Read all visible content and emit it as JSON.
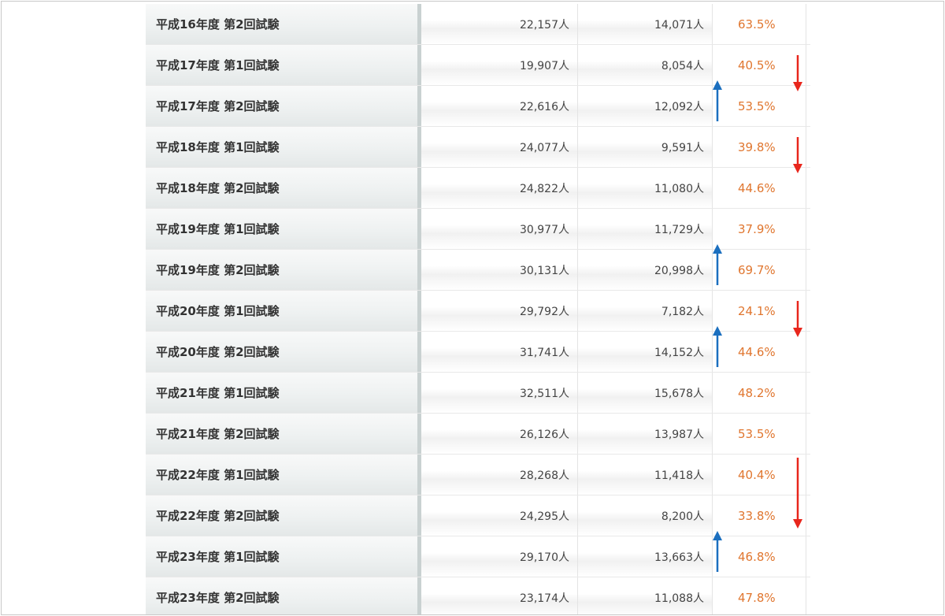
{
  "colors": {
    "rate_text": "#e0762f",
    "arrow_down": "#e8261c",
    "arrow_up": "#1b6fbf"
  },
  "rows": [
    {
      "label": "平成16年度 第2回試験",
      "applicants": "22,157人",
      "passers": "14,071人",
      "rate": "63.5%",
      "arrow": "none"
    },
    {
      "label": "平成17年度 第1回試験",
      "applicants": "19,907人",
      "passers": "8,054人",
      "rate": "40.5%",
      "arrow": "down"
    },
    {
      "label": "平成17年度 第2回試験",
      "applicants": "22,616人",
      "passers": "12,092人",
      "rate": "53.5%",
      "arrow": "up"
    },
    {
      "label": "平成18年度 第1回試験",
      "applicants": "24,077人",
      "passers": "9,591人",
      "rate": "39.8%",
      "arrow": "down"
    },
    {
      "label": "平成18年度 第2回試験",
      "applicants": "24,822人",
      "passers": "11,080人",
      "rate": "44.6%",
      "arrow": "none"
    },
    {
      "label": "平成19年度 第1回試験",
      "applicants": "30,977人",
      "passers": "11,729人",
      "rate": "37.9%",
      "arrow": "none"
    },
    {
      "label": "平成19年度 第2回試験",
      "applicants": "30,131人",
      "passers": "20,998人",
      "rate": "69.7%",
      "arrow": "up"
    },
    {
      "label": "平成20年度 第1回試験",
      "applicants": "29,792人",
      "passers": "7,182人",
      "rate": "24.1%",
      "arrow": "down"
    },
    {
      "label": "平成20年度 第2回試験",
      "applicants": "31,741人",
      "passers": "14,152人",
      "rate": "44.6%",
      "arrow": "up"
    },
    {
      "label": "平成21年度 第1回試験",
      "applicants": "32,511人",
      "passers": "15,678人",
      "rate": "48.2%",
      "arrow": "none"
    },
    {
      "label": "平成21年度 第2回試験",
      "applicants": "26,126人",
      "passers": "13,987人",
      "rate": "53.5%",
      "arrow": "none"
    },
    {
      "label": "平成22年度 第1回試験",
      "applicants": "28,268人",
      "passers": "11,418人",
      "rate": "40.4%",
      "arrow": "down-long"
    },
    {
      "label": "平成22年度 第2回試験",
      "applicants": "24,295人",
      "passers": "8,200人",
      "rate": "33.8%",
      "arrow": "none"
    },
    {
      "label": "平成23年度 第1回試験",
      "applicants": "29,170人",
      "passers": "13,663人",
      "rate": "46.8%",
      "arrow": "up"
    },
    {
      "label": "平成23年度 第2回試験",
      "applicants": "23,174人",
      "passers": "11,088人",
      "rate": "47.8%",
      "arrow": "none"
    }
  ]
}
